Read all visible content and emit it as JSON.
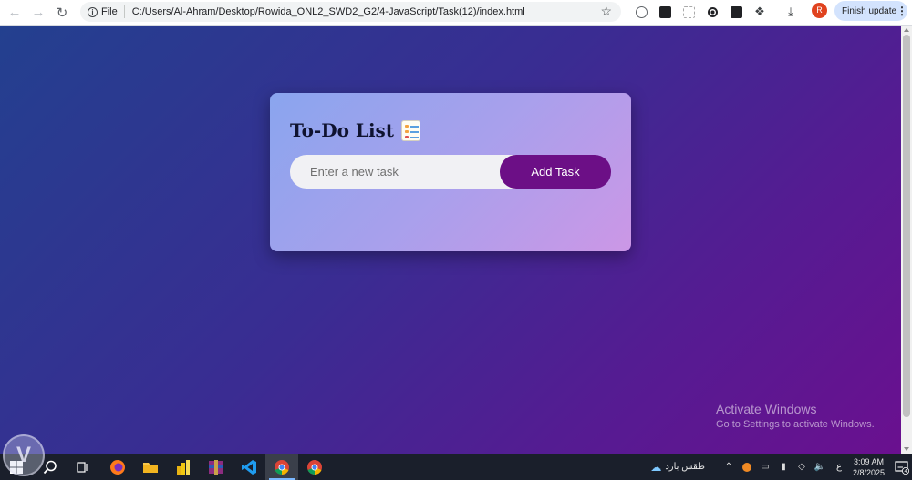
{
  "browser": {
    "scheme_label": "File",
    "url": "C:/Users/Al-Ahram/Desktop/Rowida_ONL2_SWD2_G2/4-JavaScript/Task(12)/index.html",
    "profile_initial": "R",
    "update_label": "Finish update"
  },
  "app": {
    "title": "To-Do List",
    "input_placeholder": "Enter a new task",
    "input_value": "",
    "add_button_label": "Add Task"
  },
  "watermark": {
    "title": "Activate Windows",
    "subtitle": "Go to Settings to activate Windows."
  },
  "taskbar": {
    "weather_label": "طقس بارد",
    "lang_indicator": "ع",
    "time": "3:09 AM",
    "date": "2/8/2025",
    "notification_count": "4"
  },
  "icons": [
    "back-arrow-icon",
    "forward-arrow-icon",
    "reload-icon",
    "info-icon",
    "star-icon",
    "extension-icons",
    "download-icon",
    "menu-dots-icon",
    "windows-start-icon",
    "search-icon",
    "task-view-icon",
    "firefox-icon",
    "file-explorer-icon",
    "power-bi-icon",
    "winrar-icon",
    "vscode-icon",
    "chrome-icon",
    "chrome-canary-icon",
    "checklist-icon"
  ],
  "colors": {
    "accent_button": "#6c0f86",
    "card_gradient_start": "#8aa5ee",
    "card_gradient_end": "#cc97e6"
  }
}
